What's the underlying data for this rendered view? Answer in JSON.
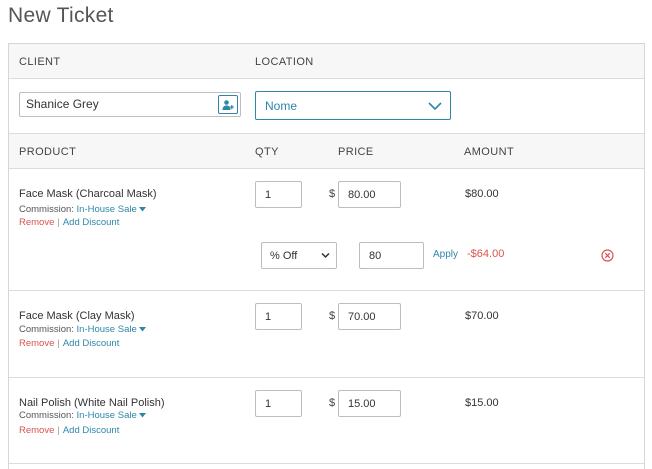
{
  "page": {
    "title": "New Ticket"
  },
  "header1": {
    "client": "CLIENT",
    "location": "LOCATION"
  },
  "client": {
    "value": "Shanice Grey"
  },
  "location": {
    "selected": "Nome"
  },
  "header2": {
    "product": "PRODUCT",
    "qty": "QTY",
    "price": "PRICE",
    "amount": "AMOUNT"
  },
  "items": [
    {
      "name": "Face Mask (Charcoal Mask)",
      "commission_label": "Commission:",
      "commission_value": "In-House Sale",
      "remove": "Remove",
      "separator": "|",
      "add_discount": "Add Discount",
      "qty": "1",
      "currency": "$",
      "price": "80.00",
      "amount": "$80.00",
      "discount": {
        "type": "% Off",
        "value": "80",
        "apply": "Apply",
        "amount": "-$64.00"
      }
    },
    {
      "name": "Face Mask (Clay Mask)",
      "commission_label": "Commission:",
      "commission_value": "In-House Sale",
      "remove": "Remove",
      "separator": "|",
      "add_discount": "Add Discount",
      "qty": "1",
      "currency": "$",
      "price": "70.00",
      "amount": "$70.00"
    },
    {
      "name": "Nail Polish (White Nail Polish)",
      "commission_label": "Commission:",
      "commission_value": "In-House Sale",
      "remove": "Remove",
      "separator": "|",
      "add_discount": "Add Discount",
      "qty": "1",
      "currency": "$",
      "price": "15.00",
      "amount": "$15.00"
    }
  ],
  "colors": {
    "accent": "#2e86a9",
    "danger": "#d9534f",
    "header_bg": "#f7f7f7",
    "border": "#dcdcdc"
  },
  "icons": {
    "add_client": "add-person-icon",
    "dropdown": "chevron-down-icon",
    "caret": "caret-down-icon",
    "remove_discount": "circle-x-icon"
  }
}
